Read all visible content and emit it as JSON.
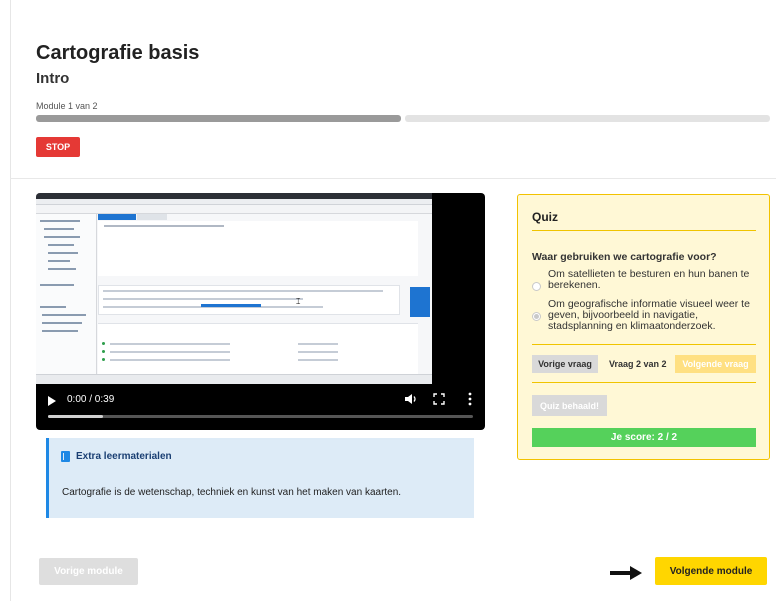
{
  "course": {
    "title": "Cartografie basis",
    "subtitle": "Intro",
    "module_label": "Module 1 van 2",
    "progress_fraction": 0.5,
    "stop_label": "STOP"
  },
  "video": {
    "time": "0:00 / 0:39",
    "played_fraction": 0.0,
    "icons": [
      "play-icon",
      "volume-icon",
      "fullscreen-icon",
      "more-options-icon"
    ]
  },
  "extra": {
    "title": "Extra leermaterialen",
    "icon": "book-icon",
    "text": "Cartografie is de wetenschap, techniek en kunst van het maken van kaarten."
  },
  "quiz": {
    "title": "Quiz",
    "question": "Waar gebruiken we cartografie voor?",
    "options": [
      {
        "text": "Om satellieten te besturen en hun banen te berekenen.",
        "selected": false
      },
      {
        "text": "Om geografische informatie visueel weer te geven, bijvoorbeeld in navigatie, stadsplanning en klimaatonderzoek.",
        "selected": true
      }
    ],
    "prev_label": "Vorige vraag",
    "counter": "Vraag 2 van 2",
    "next_label": "Volgende vraag",
    "passed_label": "Quiz behaald!",
    "score": "Je score: 2 / 2"
  },
  "nav": {
    "prev_module": "Vorige module",
    "next_module": "Volgende module"
  },
  "colors": {
    "stop": "#e53935",
    "quiz_border": "#f2c200",
    "quiz_bg": "#fff8d6",
    "score": "#55d15b",
    "next_module": "#ffd600",
    "extra_bg": "#ddebf7",
    "extra_accent": "#1e88e5"
  }
}
